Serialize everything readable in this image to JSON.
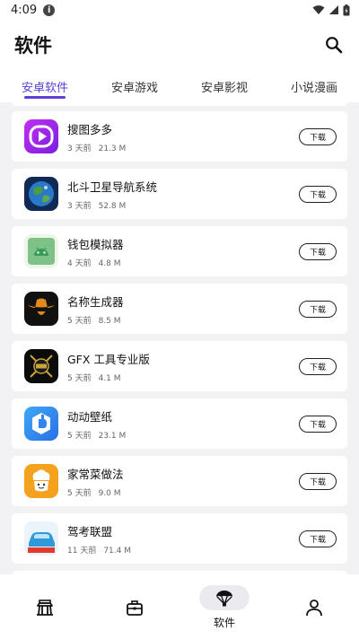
{
  "status": {
    "time": "4:09",
    "info_glyph": "i"
  },
  "header": {
    "title": "软件"
  },
  "tabs": [
    {
      "label": "安卓软件",
      "active": true
    },
    {
      "label": "安卓游戏",
      "active": false
    },
    {
      "label": "安卓影视",
      "active": false
    },
    {
      "label": "小说漫画",
      "active": false
    }
  ],
  "apps": [
    {
      "name": "搜图多多",
      "age": "3 天前",
      "size": "21.3 M",
      "button": "下载",
      "icon": "play-logo-icon"
    },
    {
      "name": "北斗卫星导航系统",
      "age": "3 天前",
      "size": "52.8 M",
      "button": "下载",
      "icon": "globe-icon"
    },
    {
      "name": "钱包模拟器",
      "age": "4 天前",
      "size": "4.8 M",
      "button": "下载",
      "icon": "android-icon"
    },
    {
      "name": "名称生成器",
      "age": "5 天前",
      "size": "8.5 M",
      "button": "下载",
      "icon": "cowboy-icon"
    },
    {
      "name": "GFX 工具专业版",
      "age": "5 天前",
      "size": "4.1 M",
      "button": "下载",
      "icon": "gfx-badge-icon"
    },
    {
      "name": "动动壁纸",
      "age": "5 天前",
      "size": "23.1 M",
      "button": "下载",
      "icon": "cube-logo-icon"
    },
    {
      "name": "家常菜做法",
      "age": "5 天前",
      "size": "9.0 M",
      "button": "下载",
      "icon": "chef-icon"
    },
    {
      "name": "驾考联盟",
      "age": "11 天前",
      "size": "71.4 M",
      "button": "下载",
      "icon": "car-icon"
    }
  ],
  "bottom_nav": [
    {
      "label": "",
      "icon": "home-icon",
      "active": false
    },
    {
      "label": "",
      "icon": "briefcase-icon",
      "active": false
    },
    {
      "label": "软件",
      "icon": "parachute-icon",
      "active": true
    },
    {
      "label": "",
      "icon": "person-icon",
      "active": false
    }
  ],
  "colors": {
    "accent": "#5b3fd6",
    "background": "#f2f2f5"
  }
}
